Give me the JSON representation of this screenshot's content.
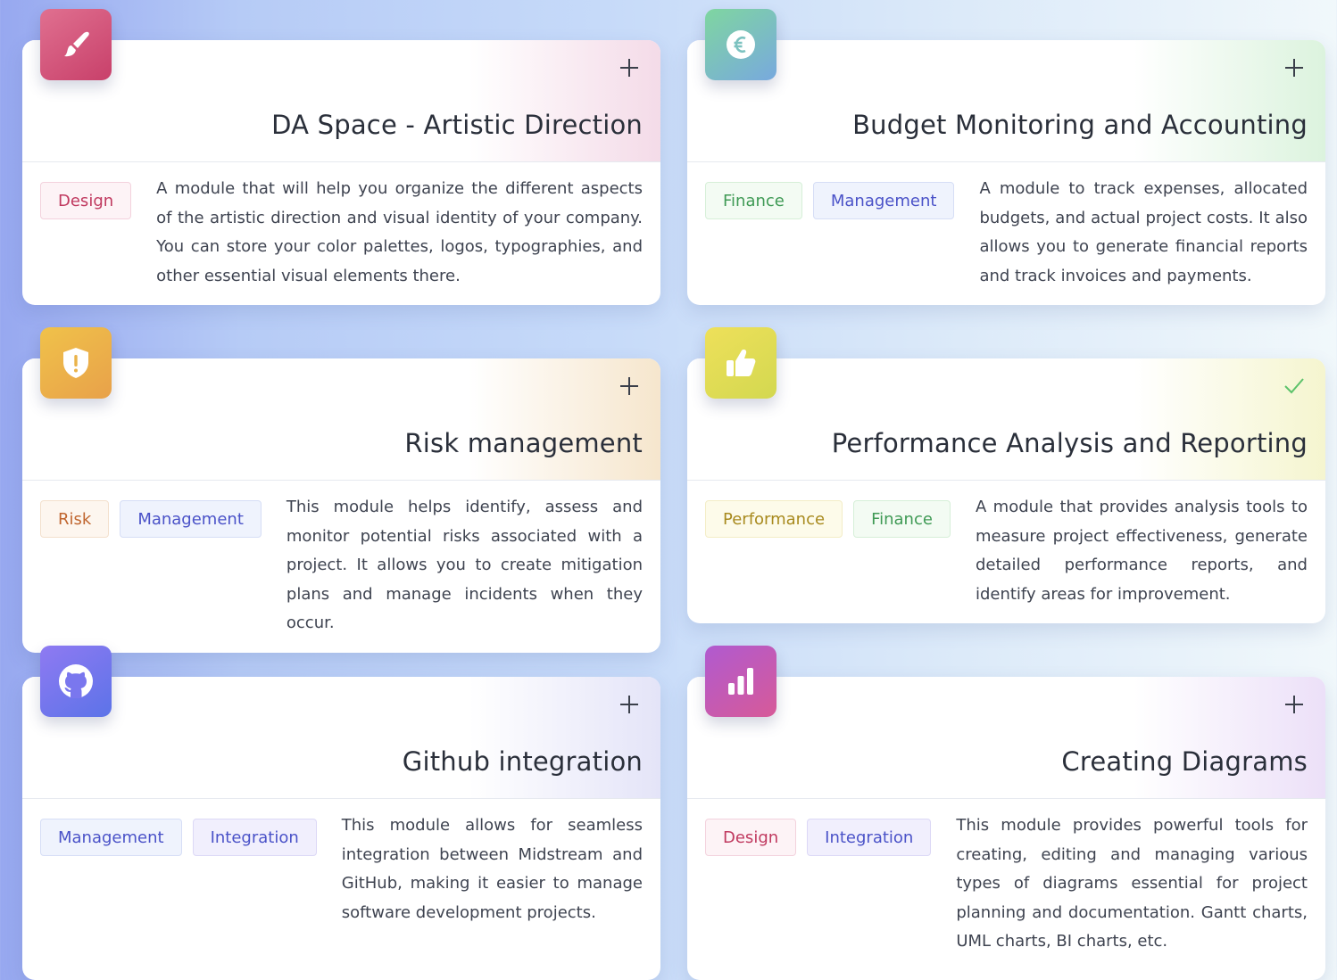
{
  "modules": [
    {
      "title": "DA Space - Artistic Direction",
      "action_icon": "plus-icon",
      "icon": "paintbrush-icon",
      "tags": [
        {
          "label": "Design",
          "color": "#c0395f"
        }
      ],
      "description": "A module that will help you organize the different aspects of the artistic direction and visual identity of your company. You can store your color palettes, logos, typographies, and other essential visual elements there.",
      "accent": "#f4dbe8"
    },
    {
      "title": "Budget Monitoring and Accounting",
      "action_icon": "plus-icon",
      "icon": "euro-icon",
      "tags": [
        {
          "label": "Finance",
          "color": "#3f9a55"
        },
        {
          "label": "Management",
          "color": "#4a52c8"
        }
      ],
      "description": "A module to track expenses, allocated budgets, and actual project costs. It also allows you to generate financial reports and track invoices and payments.",
      "accent": "#dcf3de"
    },
    {
      "title": "Risk management",
      "action_icon": "plus-icon",
      "icon": "shield-alert-icon",
      "tags": [
        {
          "label": "Risk",
          "color": "#c0652e"
        },
        {
          "label": "Management",
          "color": "#4a52c8"
        }
      ],
      "description": "This module helps identify, assess and monitor potential risks associated with a project. It allows you to create mitigation plans and manage incidents when they occur.",
      "accent": "#f6e6cd"
    },
    {
      "title": "Performance Analysis and Reporting",
      "action_icon": "check-icon",
      "icon": "thumbs-up-icon",
      "tags": [
        {
          "label": "Performance",
          "color": "#a88a1e"
        },
        {
          "label": "Finance",
          "color": "#3f9a55"
        }
      ],
      "description": "A module that provides analysis tools to measure project effectiveness, generate detailed performance reports, and identify areas for improvement.",
      "accent": "#f5f5cf"
    },
    {
      "title": "Github integration",
      "action_icon": "plus-icon",
      "icon": "github-icon",
      "tags": [
        {
          "label": "Management",
          "color": "#4a52c8"
        },
        {
          "label": "Integration",
          "color": "#4a52c8"
        }
      ],
      "description": "This module allows for seamless integration between Midstream and GitHub, making it easier to manage software development projects.",
      "accent": "#e4e4f8"
    },
    {
      "title": "Creating Diagrams",
      "action_icon": "plus-icon",
      "icon": "bar-chart-icon",
      "tags": [
        {
          "label": "Design",
          "color": "#c0395f"
        },
        {
          "label": "Integration",
          "color": "#4a52c8"
        }
      ],
      "description": "This module provides powerful tools for creating, editing and managing various types of diagrams essential for project planning and documentation. Gantt charts, UML charts, BI charts, etc.",
      "accent": "#ece0f8"
    }
  ]
}
